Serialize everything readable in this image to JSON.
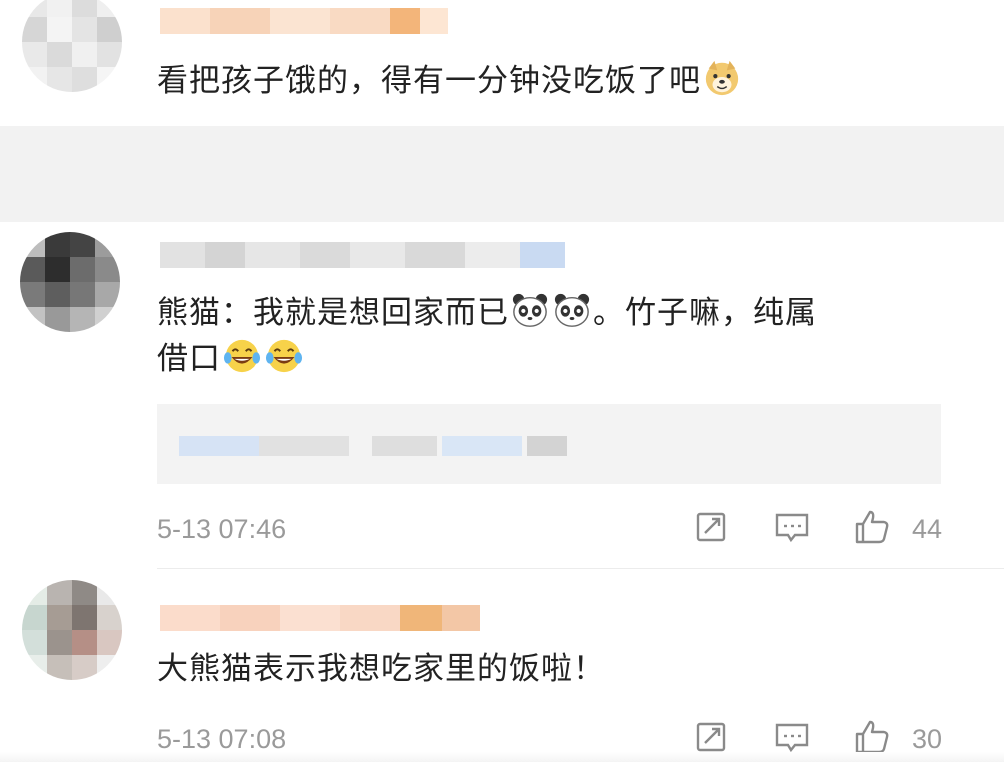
{
  "comments": [
    {
      "text": "看把孩子饿的，得有一分钟没吃饭了吧",
      "emojis": [
        "doge"
      ]
    },
    {
      "text_a": "熊猫：我就是想回家而已",
      "text_b": "。竹子嘛，纯属",
      "text_c": "借口",
      "emojis_mid": [
        "panda",
        "panda"
      ],
      "emojis_end": [
        "laugh-cry",
        "laugh-cry"
      ],
      "time": "5-13 07:46",
      "likes": "44"
    },
    {
      "text": "大熊猫表示我想吃家里的饭啦！",
      "time": "5-13 07:08",
      "likes": "30"
    }
  ],
  "colors": {
    "page_gap": "#f2f2f2",
    "meta_text": "#9a9a9a",
    "name_blur_orange": "#f7c8a4",
    "name_blur_gray": "#d9d9d9",
    "quote_bg": "#f3f3f3"
  },
  "icons": [
    "doge-emoji",
    "panda-emoji",
    "laugh-cry-emoji",
    "share-icon",
    "comment-icon",
    "like-icon"
  ]
}
